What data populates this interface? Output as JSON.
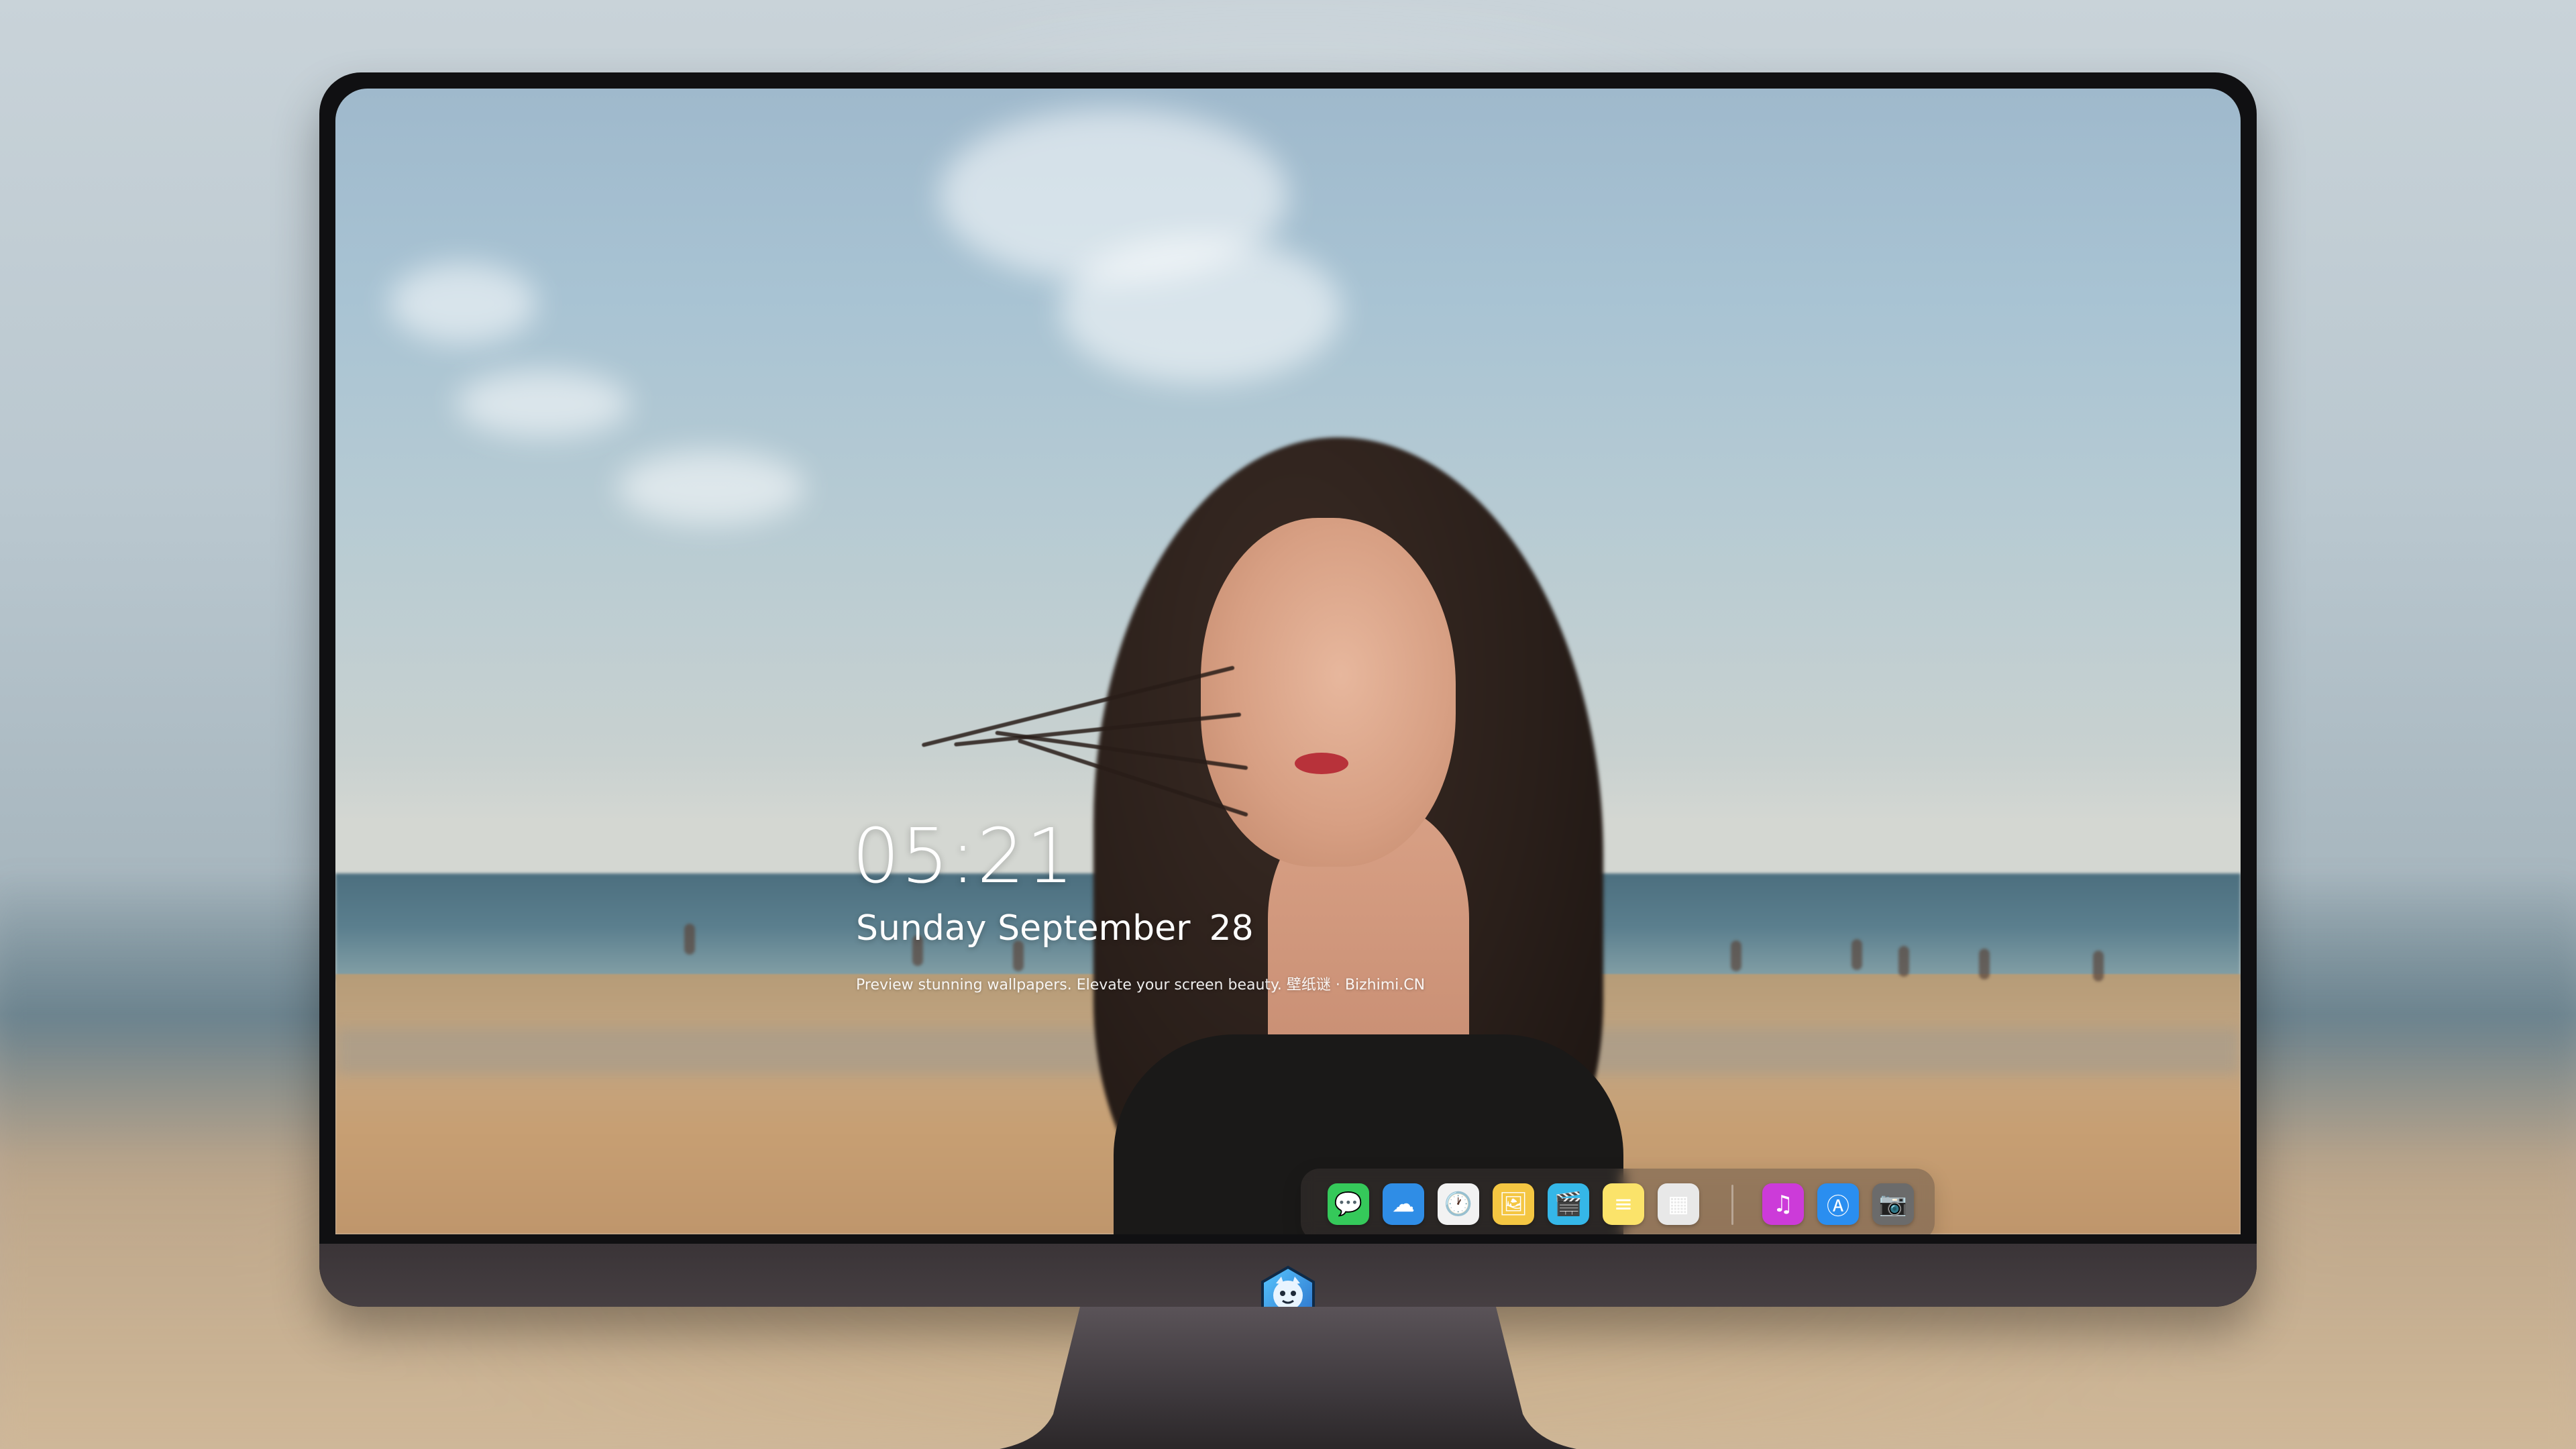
{
  "lockscreen": {
    "time": "05:21",
    "weekday_month": "Sunday September",
    "day": "28",
    "tagline": "Preview stunning wallpapers. Elevate your screen beauty. 壁纸谜 · Bizhimi.CN"
  },
  "dock": {
    "apps": [
      {
        "name": "messages-icon",
        "glyph": "💬",
        "color": "#35c95a"
      },
      {
        "name": "weather-icon",
        "glyph": "☁",
        "color": "#2f8de6"
      },
      {
        "name": "clock-icon",
        "glyph": "🕐",
        "color": "#f2f2f2"
      },
      {
        "name": "preview-icon",
        "glyph": "🖼",
        "color": "#f4c642"
      },
      {
        "name": "clapboard-icon",
        "glyph": "🎬",
        "color": "#35b7e8"
      },
      {
        "name": "notes-icon",
        "glyph": "≡",
        "color": "#fbe36a"
      },
      {
        "name": "photo-booth-icon",
        "glyph": "▦",
        "color": "#e8e8e8"
      },
      {
        "name": "music-icon",
        "glyph": "♫",
        "color": "#cc3bd9"
      },
      {
        "name": "app-store-icon",
        "glyph": "Ⓐ",
        "color": "#2a8ef0"
      },
      {
        "name": "camera-icon",
        "glyph": "📷",
        "color": "#6b6b6b"
      }
    ]
  },
  "monitor": {
    "logo": "monitor-logo-icon"
  }
}
